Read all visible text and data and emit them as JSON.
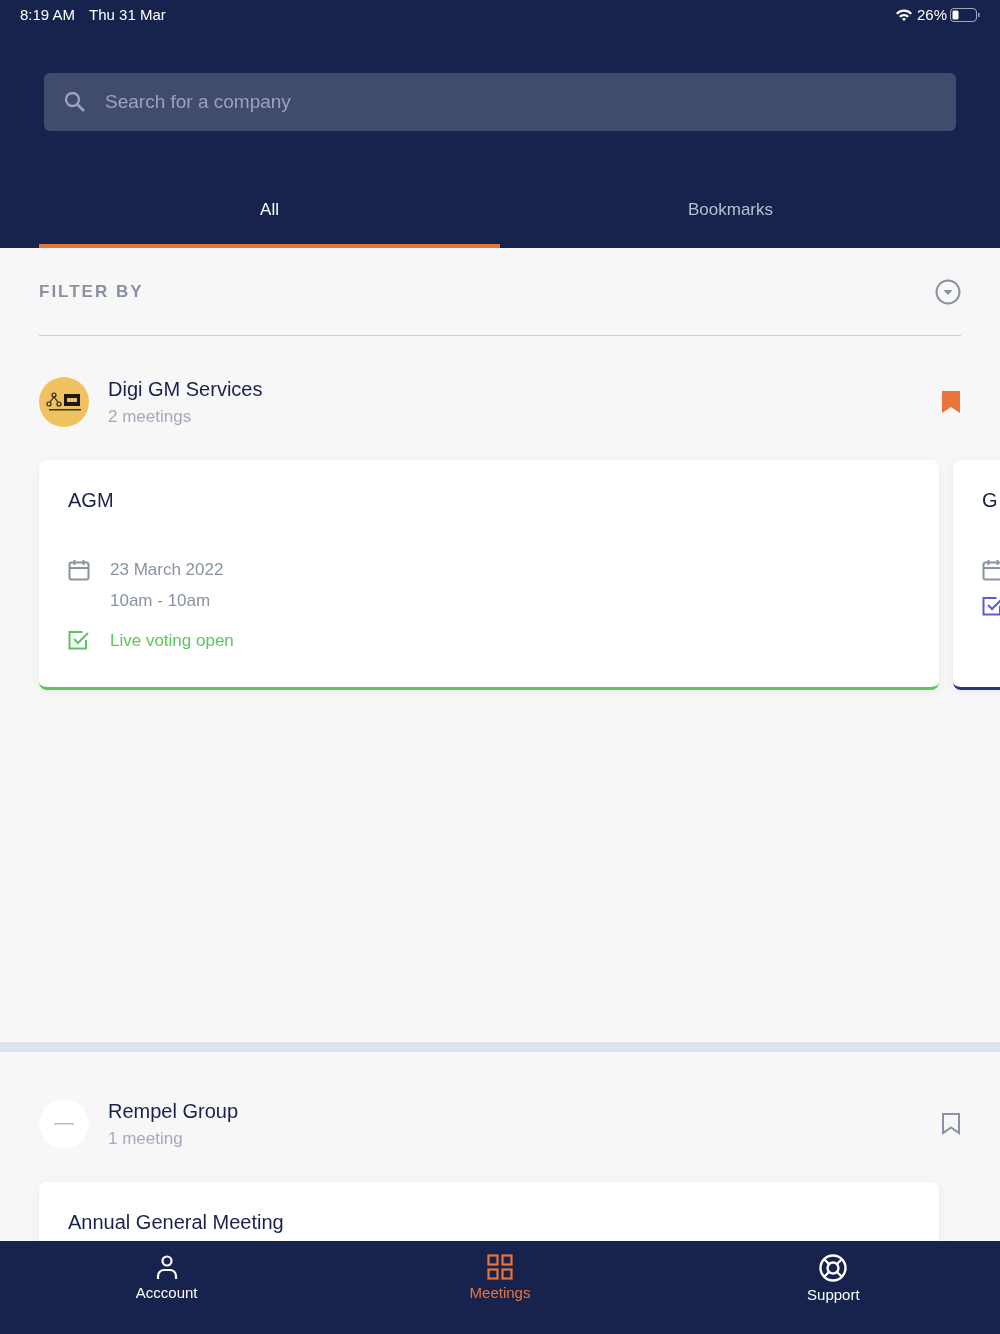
{
  "status_bar": {
    "time": "8:19 AM",
    "date": "Thu 31 Mar",
    "battery": "26%"
  },
  "search": {
    "placeholder": "Search for a company"
  },
  "tabs": [
    {
      "label": "All",
      "selected": true
    },
    {
      "label": "Bookmarks",
      "selected": false
    }
  ],
  "filter": {
    "label": "FILTER BY",
    "expanded": false
  },
  "companies": [
    {
      "name": "Digi GM Services",
      "count": "2 meetings",
      "bookmarked": true,
      "kind": "badge",
      "meetings": [
        {
          "title": "AGM",
          "date": "23 March 2022",
          "time": "10am - 10am",
          "status": "Live voting open",
          "color": "#5cc45f"
        },
        {
          "title": "G",
          "color": "#27318b"
        }
      ]
    },
    {
      "name": "Rempel Group",
      "count": "1 meeting",
      "bookmarked": false,
      "kind": "blank",
      "meetings": [
        {
          "title": "Annual General Meeting",
          "color": "#ffffff"
        }
      ]
    }
  ],
  "nav": [
    {
      "label": "Acccount",
      "kind": "person",
      "selected": false
    },
    {
      "label": "Meetings",
      "kind": "grid",
      "selected": true
    },
    {
      "label": "Support",
      "kind": "lifebuoy",
      "selected": false
    }
  ]
}
